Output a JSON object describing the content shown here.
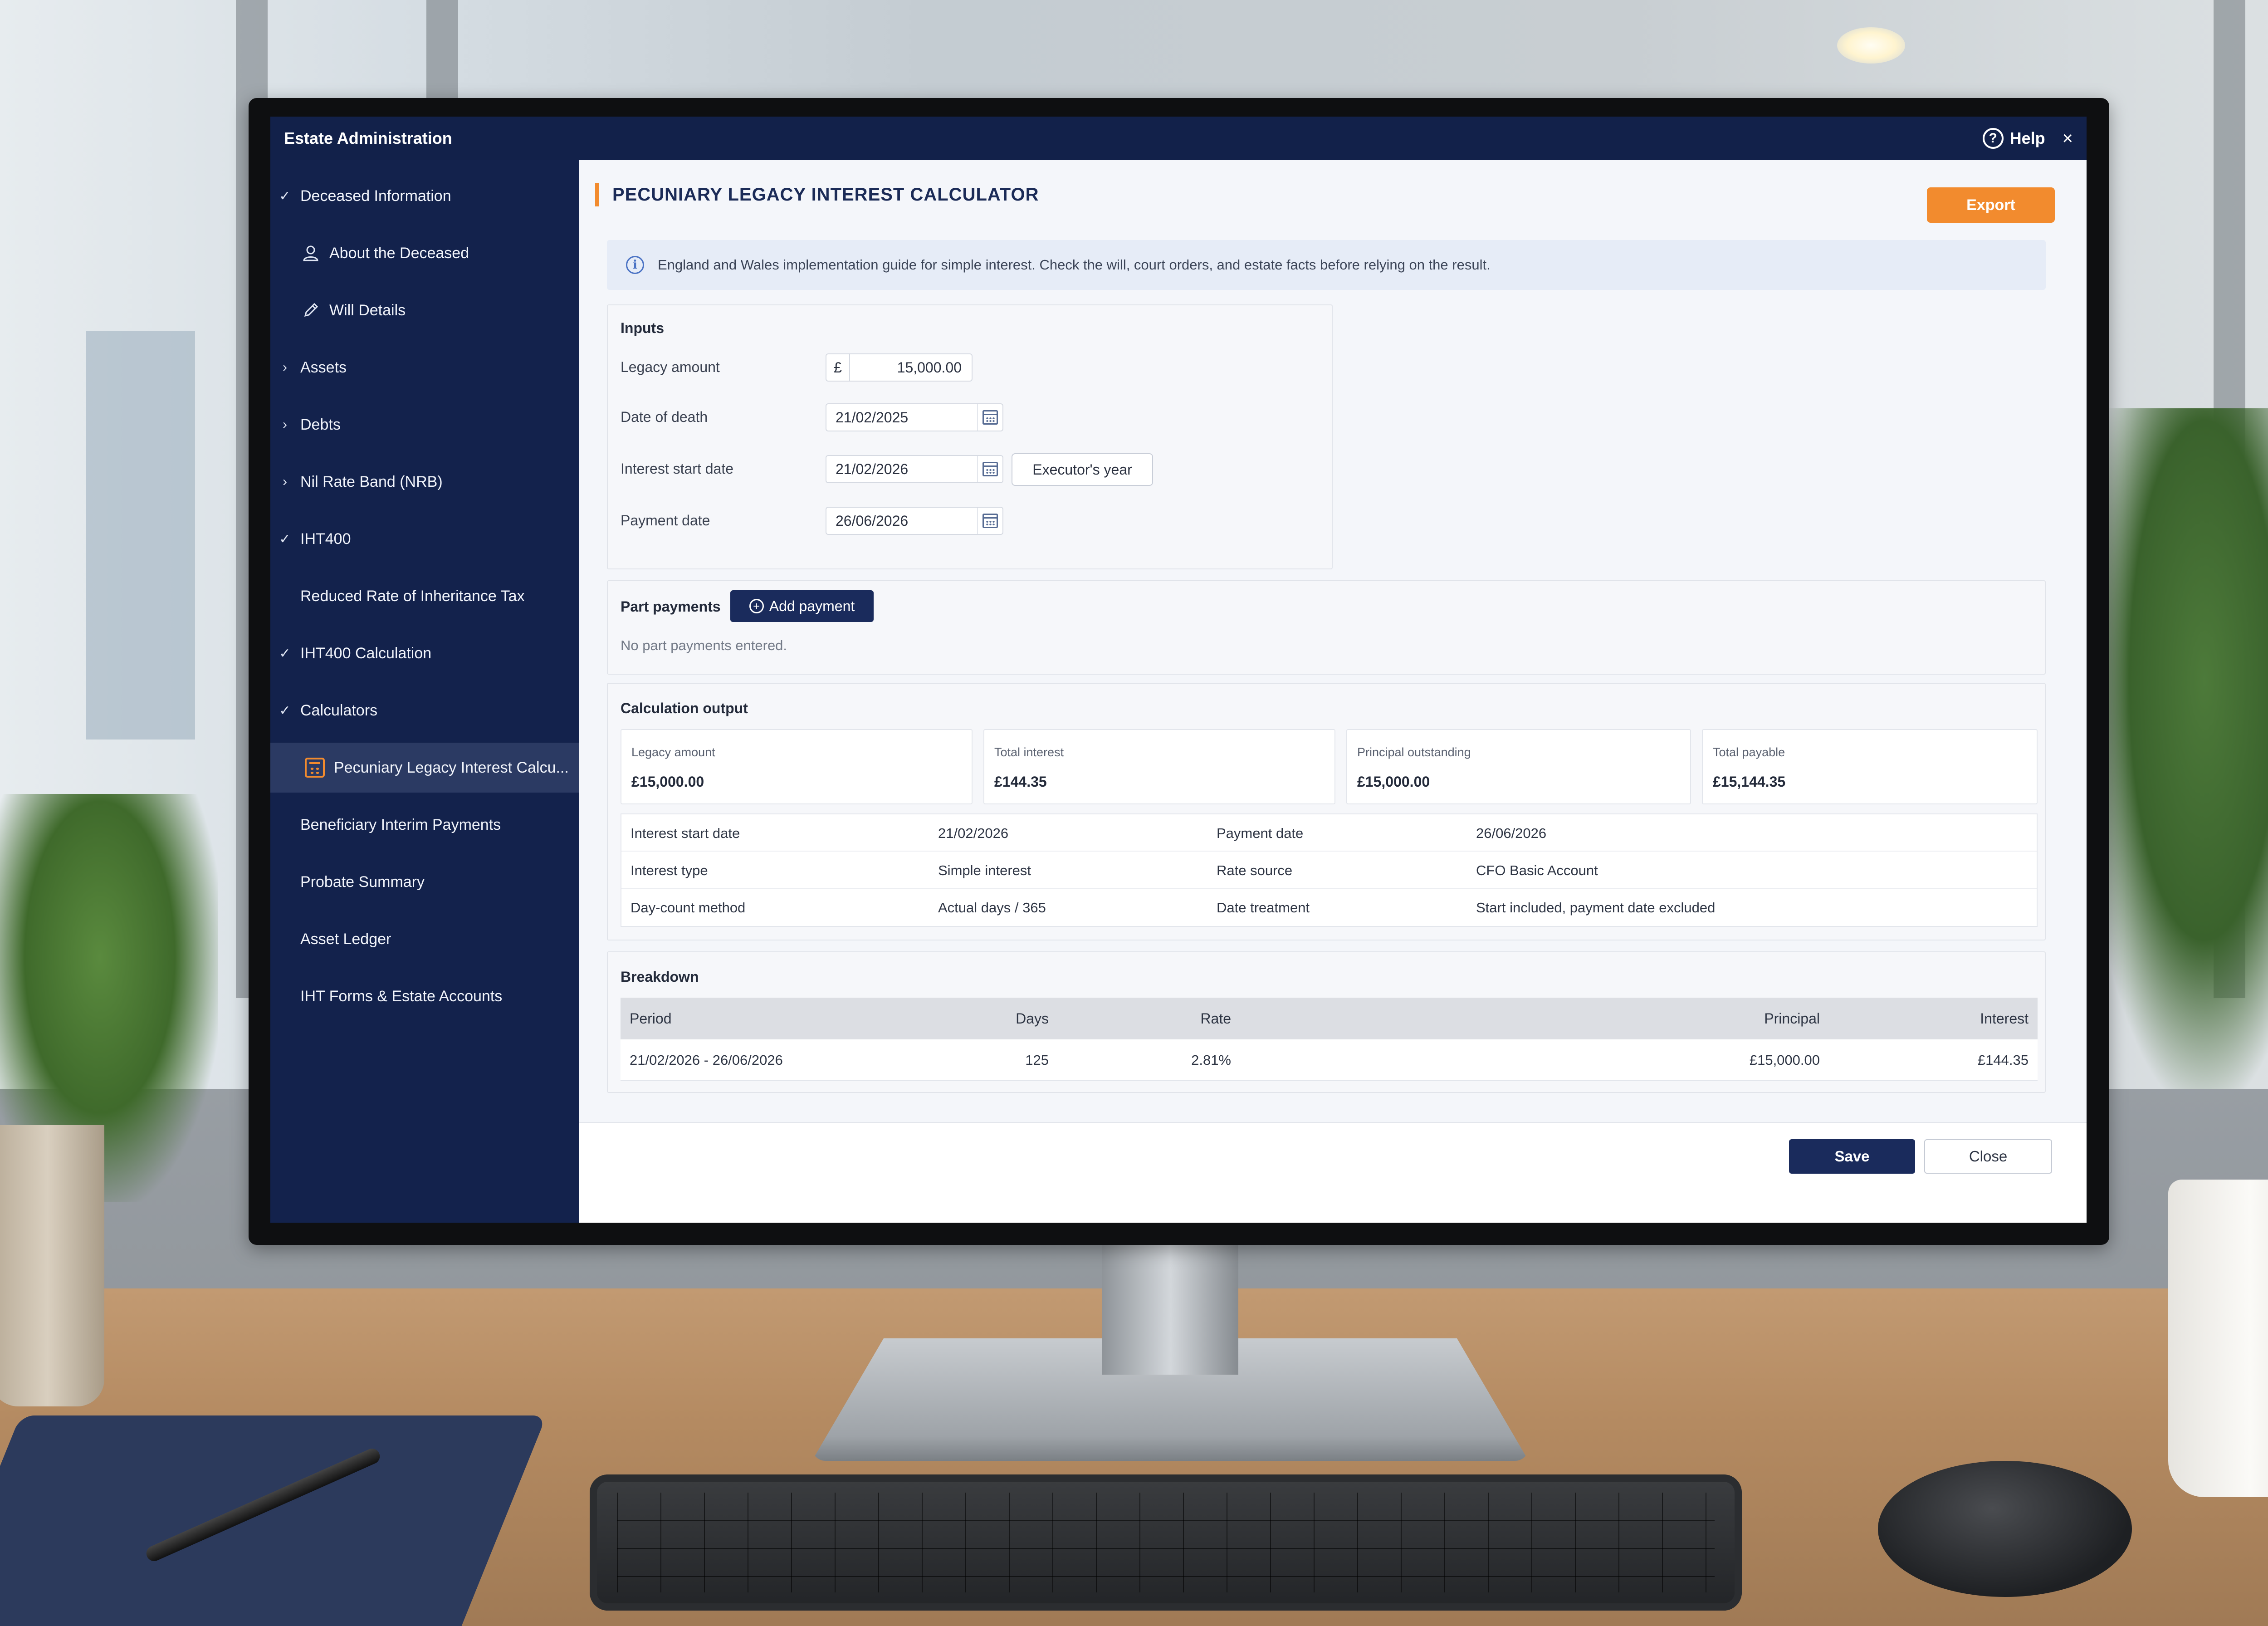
{
  "window": {
    "title": "Estate Administration",
    "help_label": "Help",
    "close_glyph": "×"
  },
  "sidebar": {
    "items": [
      {
        "label": "Deceased Information",
        "marker": "✓"
      },
      {
        "label": "About the Deceased",
        "icon": "person-icon"
      },
      {
        "label": "Will Details",
        "icon": "pen-icon"
      },
      {
        "label": "Assets",
        "marker": "›"
      },
      {
        "label": "Debts",
        "marker": "›"
      },
      {
        "label": "Nil Rate Band (NRB)",
        "marker": "›"
      },
      {
        "label": "IHT400",
        "marker": "✓"
      },
      {
        "label": "Reduced Rate of Inheritance Tax"
      },
      {
        "label": "IHT400 Calculation",
        "marker": "✓"
      },
      {
        "label": "Calculators",
        "marker": "✓"
      },
      {
        "label": "Pecuniary Legacy Interest Calcu...",
        "icon": "calculator-icon",
        "active": true
      },
      {
        "label": "Beneficiary Interim Payments"
      },
      {
        "label": "Probate Summary"
      },
      {
        "label": "Asset Ledger"
      },
      {
        "label": "IHT Forms & Estate Accounts"
      }
    ]
  },
  "main": {
    "title": "PECUNIARY LEGACY INTEREST CALCULATOR",
    "export_label": "Export",
    "banner": "England and Wales implementation guide for simple interest. Check the will, court orders, and estate facts before relying on the result.",
    "inputs": {
      "heading": "Inputs",
      "legacy_amount_label": "Legacy amount",
      "currency_symbol": "£",
      "legacy_amount_value": "15,000.00",
      "date_of_death_label": "Date of death",
      "date_of_death_value": "21/02/2025",
      "interest_start_label": "Interest start date",
      "interest_start_value": "21/02/2026",
      "executors_year_label": "Executor's year",
      "payment_date_label": "Payment date",
      "payment_date_value": "26/06/2026"
    },
    "part_payments": {
      "heading": "Part payments",
      "add_label": "Add payment",
      "empty_text": "No part payments entered."
    },
    "output": {
      "heading": "Calculation output",
      "cards": [
        {
          "label": "Legacy amount",
          "value": "£15,000.00"
        },
        {
          "label": "Total interest",
          "value": "£144.35"
        },
        {
          "label": "Principal outstanding",
          "value": "£15,000.00"
        },
        {
          "label": "Total payable",
          "value": "£15,144.35"
        }
      ],
      "details": [
        {
          "k1": "Interest start date",
          "v1": "21/02/2026",
          "k2": "Payment date",
          "v2": "26/06/2026"
        },
        {
          "k1": "Interest type",
          "v1": "Simple interest",
          "k2": "Rate source",
          "v2": "CFO Basic Account"
        },
        {
          "k1": "Day-count method",
          "v1": "Actual days / 365",
          "k2": "Date treatment",
          "v2": "Start included, payment date excluded"
        }
      ]
    },
    "breakdown": {
      "heading": "Breakdown",
      "columns": [
        "Period",
        "Days",
        "Rate",
        "Principal",
        "Interest"
      ],
      "rows": [
        {
          "period": "21/02/2026 - 26/06/2026",
          "days": "125",
          "rate": "2.81%",
          "principal": "£15,000.00",
          "interest": "£144.35"
        }
      ]
    },
    "footer": {
      "save_label": "Save",
      "close_label": "Close"
    }
  }
}
